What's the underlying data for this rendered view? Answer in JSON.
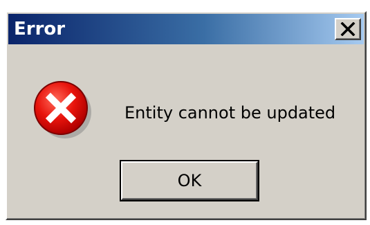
{
  "window": {
    "title": "Error",
    "close_icon": "close-icon"
  },
  "content": {
    "icon": "error-icon",
    "message": "Entity cannot be updated"
  },
  "buttons": {
    "ok_label": "OK"
  },
  "colors": {
    "titlebar_start": "#0a246a",
    "titlebar_end": "#a6caf0",
    "dialog_bg": "#d4d0c8",
    "error_red": "#e00000"
  }
}
